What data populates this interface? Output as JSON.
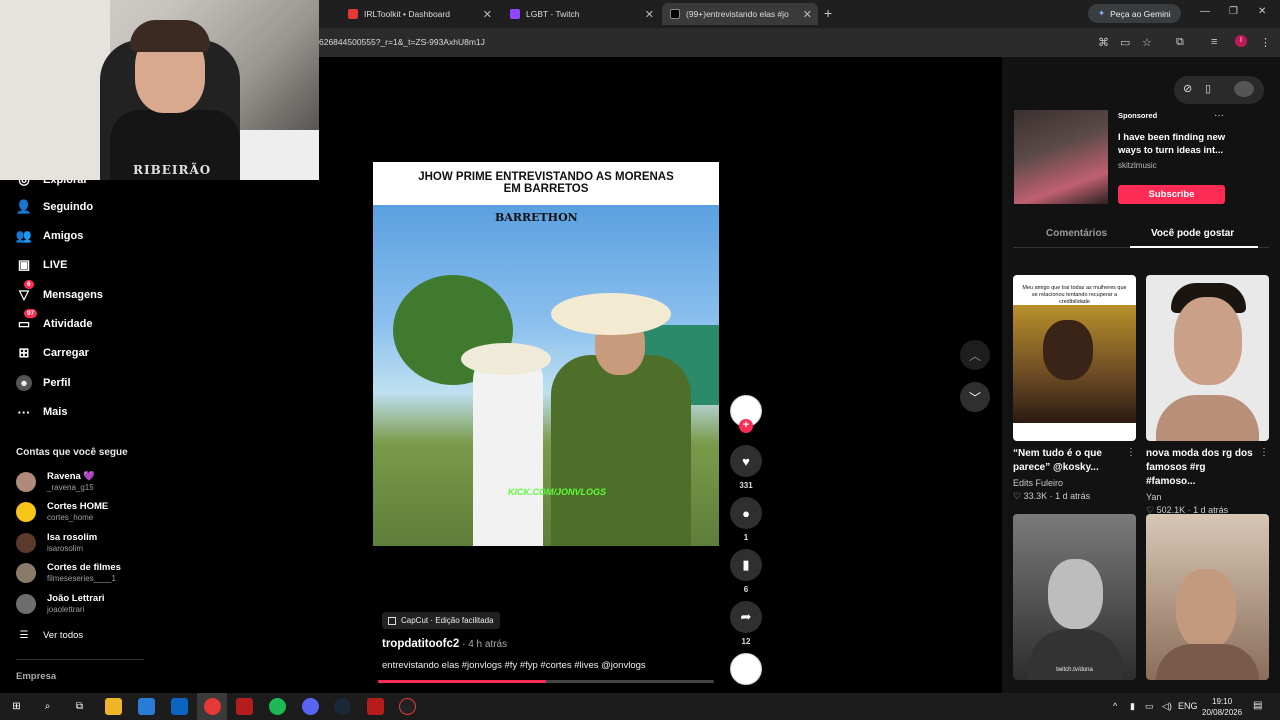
{
  "browser": {
    "tabs": [
      {
        "label": "IRLToolkit • Dashboard"
      },
      {
        "label": "LGBT - Twitch"
      },
      {
        "label": "(99+)entrevistando elas #jo"
      }
    ],
    "gemini_label": "Peça ao Gemini",
    "url": "626844500555?_r=1&_t=ZS-993AxhU8m1J",
    "profile_initial": "I"
  },
  "webcam": {
    "shirt_text": "RIBEIRÃO"
  },
  "sidebar": {
    "partial_item": "Explorar",
    "items": [
      {
        "label": "Seguindo",
        "icon": "following-icon"
      },
      {
        "label": "Amigos",
        "icon": "friends-icon"
      },
      {
        "label": "LIVE",
        "icon": "live-icon"
      },
      {
        "label": "Mensagens",
        "icon": "messages-icon",
        "badge": "6"
      },
      {
        "label": "Atividade",
        "icon": "activity-icon",
        "badge": "97"
      },
      {
        "label": "Carregar",
        "icon": "upload-icon"
      },
      {
        "label": "Perfil",
        "icon": "profile-icon"
      },
      {
        "label": "Mais",
        "icon": "more-icon"
      }
    ],
    "following_title": "Contas que você segue",
    "accounts": [
      {
        "name": "Ravena 💜",
        "user": "_ravena_g15",
        "color": "#b08a7a"
      },
      {
        "name": "Cortes HOME",
        "user": "cortes_home",
        "color": "#f5c518"
      },
      {
        "name": "Isa rosolim",
        "user": "isarosolim",
        "color": "#5b3a2e"
      },
      {
        "name": "Cortes de filmes",
        "user": "filmeseseries____1",
        "color": "#8a7a6a"
      },
      {
        "name": "João Lettrari",
        "user": "joaolettrari",
        "color": "#6d6d6d"
      }
    ],
    "see_all": "Ver todos",
    "company": "Empresa"
  },
  "video": {
    "headline_line1": "JHOW PRIME ENTREVISTANDO AS MORENAS",
    "headline_line2": "EM BARRETOS",
    "watermark_logo": "BARRETHON",
    "overlay_text": "KICK.COM/JONVLOGS",
    "progress": 0.5,
    "capcut_label": "CapCut · Edição facilitada",
    "author": "tropdatitoofc2",
    "time": " · 4 h atrás",
    "caption": "entrevistando elas #jonvlogs #fy #fyp #cortes #lives @jonvlogs"
  },
  "actions": {
    "likes": "331",
    "comments": "1",
    "saves": "6",
    "shares": "12"
  },
  "ad": {
    "sponsored": "Sponsored",
    "title": "I have been finding new ways to turn ideas int...",
    "brand": "skitzlmusic",
    "cta": "Subscribe"
  },
  "tabs": {
    "comments": "Comentários",
    "suggested": "Você pode gostar"
  },
  "cards": [
    {
      "title": "“Nem tudo é o que parece” @kosky...",
      "author": "Edits Fuleiro",
      "likes": "33.3K",
      "age": "1 d atrás",
      "thumb_text": "Meu amigo que trai todas as mulheres que se relacionou tentando recuperar a credibilidade"
    },
    {
      "title": "nova moda dos rg dos famosos #rg #famoso...",
      "author": "Yan",
      "likes": "502.1K",
      "age": "1 d atrás"
    },
    {
      "thumb_text": "twitch.tv/dona"
    },
    {}
  ],
  "taskbar": {
    "lang": "ENG",
    "time": "19:10",
    "date": "20/08/2026"
  }
}
